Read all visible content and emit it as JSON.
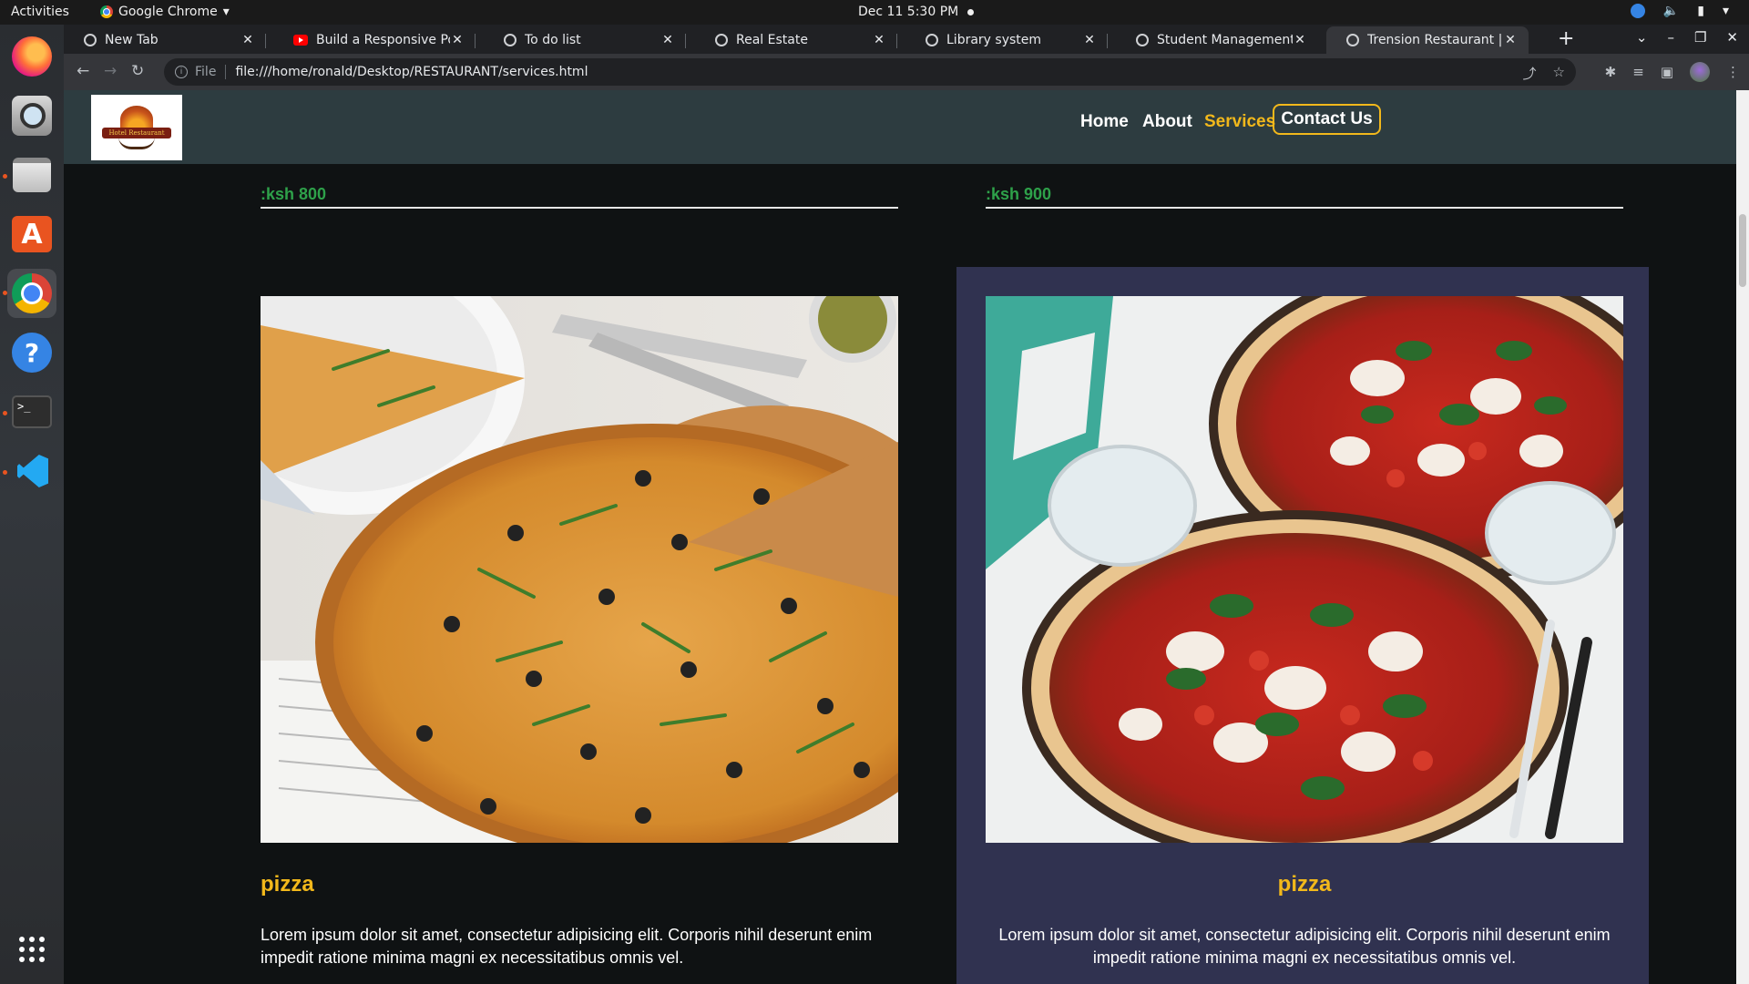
{
  "topbar": {
    "activities": "Activities",
    "app_name": "Google Chrome",
    "clock": "Dec 11   5:30 PM"
  },
  "tabs": [
    {
      "title": "New Tab",
      "icon": "globe-icon"
    },
    {
      "title": "Build a Responsive Portf",
      "icon": "youtube-icon"
    },
    {
      "title": "To do list",
      "icon": "globe-icon"
    },
    {
      "title": "Real Estate",
      "icon": "globe-icon"
    },
    {
      "title": "Library system",
      "icon": "globe-icon"
    },
    {
      "title": "Student Management Sy",
      "icon": "globe-icon"
    },
    {
      "title": "Trension Restaurant | se",
      "icon": "globe-icon",
      "active": true
    }
  ],
  "omnibox": {
    "scheme": "File",
    "url": "file:///home/ronald/Desktop/RESTAURANT/services.html"
  },
  "site": {
    "logo_text": "Hotel Restaurant",
    "nav": [
      {
        "label": "Home",
        "current": false
      },
      {
        "label": "About",
        "current": false
      },
      {
        "label": "Services",
        "current": true
      }
    ],
    "contact_label": "Contact Us",
    "accent_color": "#f2b81b",
    "price_color": "#2ea14a",
    "card_highlight_color": "#303250"
  },
  "items": [
    {
      "price": ":ksh 800",
      "name": "pizza",
      "description": "Lorem ipsum dolor sit amet, consectetur adipisicing elit. Corporis nihil deserunt enim impedit ratione minima magni ex necessitatibus omnis vel."
    },
    {
      "price": ":ksh 900",
      "name": "pizza",
      "description": "Lorem ipsum dolor sit amet, consectetur adipisicing elit. Corporis nihil deserunt enim impedit ratione minima magni ex necessitatibus omnis vel."
    }
  ]
}
